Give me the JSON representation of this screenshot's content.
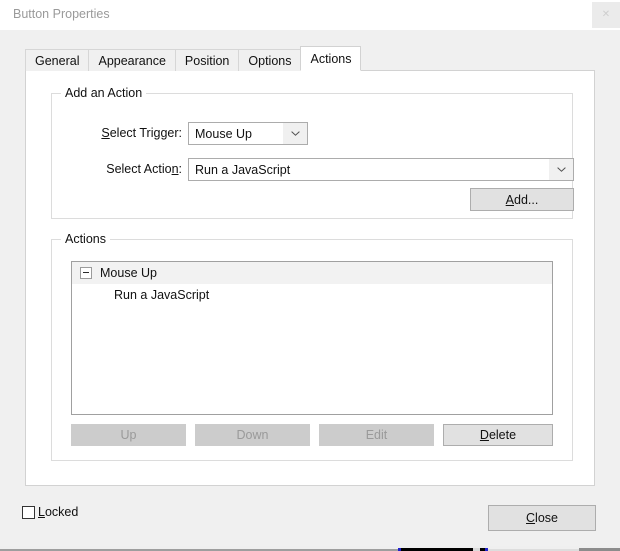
{
  "window": {
    "title": "Button Properties",
    "close_icon": "close-icon",
    "close_glyph": "✕"
  },
  "tabs": [
    {
      "label": "General",
      "active": false
    },
    {
      "label": "Appearance",
      "active": false
    },
    {
      "label": "Position",
      "active": false
    },
    {
      "label": "Options",
      "active": false
    },
    {
      "label": "Actions",
      "active": true
    }
  ],
  "add_action_group": {
    "legend": "Add an Action",
    "trigger": {
      "label_pre": "",
      "label_acc": "S",
      "label_post": "elect Trigger:",
      "label_full": "Select Trigger:",
      "value": "Mouse Up",
      "arrow_icon": "chevron-down-icon"
    },
    "action": {
      "label_pre": "Select Actio",
      "label_acc": "n",
      "label_post": ":",
      "label_full": "Select Action:",
      "value": "Run a JavaScript",
      "arrow_icon": "chevron-down-icon"
    },
    "add_button": {
      "pre": "",
      "acc": "A",
      "post": "dd...",
      "full": "Add...",
      "enabled": true
    }
  },
  "actions_group": {
    "legend": "Actions",
    "tree": [
      {
        "label": "Mouse Up",
        "expanded": true,
        "expander_icon": "collapse-minus-icon",
        "children": [
          {
            "label": "Run a JavaScript"
          }
        ]
      }
    ],
    "buttons": [
      {
        "id": "up",
        "pre": "Up",
        "acc": "",
        "post": "",
        "full": "Up",
        "enabled": false
      },
      {
        "id": "down",
        "pre": "Down",
        "acc": "",
        "post": "",
        "full": "Down",
        "enabled": false
      },
      {
        "id": "edit",
        "pre": "Edit",
        "acc": "",
        "post": "",
        "full": "Edit",
        "enabled": false
      },
      {
        "id": "delete",
        "pre": "",
        "acc": "D",
        "post": "elete",
        "full": "Delete",
        "enabled": true
      }
    ]
  },
  "footer": {
    "locked": {
      "pre": "",
      "acc": "L",
      "post": "ocked",
      "full": "Locked",
      "checked": false
    },
    "close_button": {
      "pre": "",
      "acc": "C",
      "post": "lose",
      "full": "Close"
    }
  },
  "colors": {
    "dialog_bg": "#f0f0f0",
    "panel_bg": "#ffffff",
    "titlebar_bg": "#ffffff",
    "title_text": "#9a9a9a",
    "text": "#111111",
    "disabled_text": "#9a9a9a",
    "button_face": "#e1e1e1",
    "button_disabled": "#cccccc",
    "border": "#adadad",
    "group_border": "#dcdcdc",
    "tree_border": "#a0a0a0",
    "tree_group_row": "#f2f2f2"
  }
}
